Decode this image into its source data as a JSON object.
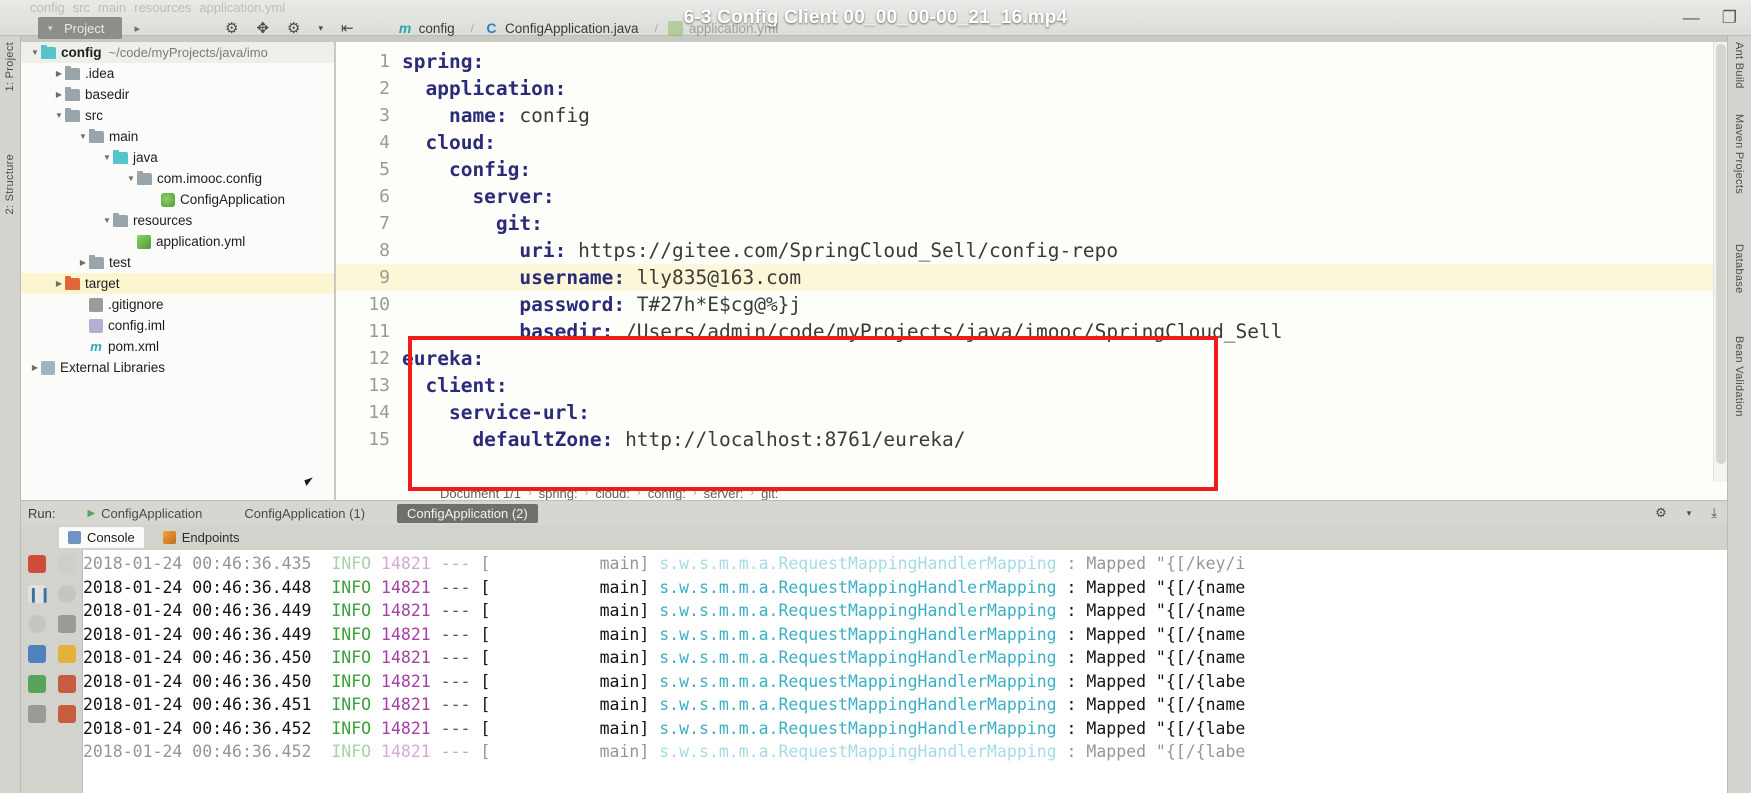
{
  "window": {
    "video_title": "6-3 Config Client 00_00_00-00_21_16.mp4",
    "minimize_label": "—",
    "maximize_label": "❐"
  },
  "ghost_breadcrumb": [
    "config",
    "src",
    "main",
    "resources",
    "application.yml"
  ],
  "toolbar": {
    "project_chip": "Project",
    "chip_chevron": "▾",
    "nav_arrow": "▸",
    "icons": [
      {
        "name": "sync-icon",
        "glyph": "⚙"
      },
      {
        "name": "target-icon",
        "glyph": "✥"
      },
      {
        "name": "settings-icon",
        "glyph": "⚙"
      },
      {
        "name": "settings-dropdown-icon",
        "glyph": "▾"
      },
      {
        "name": "collapse-all-icon",
        "glyph": "⇤"
      }
    ],
    "editor_tabs": [
      {
        "label": "config",
        "icon": "maven-icon"
      },
      {
        "label": "ConfigApplication.java",
        "icon": "java-class-icon"
      },
      {
        "label": "application.yml",
        "icon": "yaml-file-icon"
      }
    ]
  },
  "left_strip": [
    "1: Project",
    "2: Structure"
  ],
  "right_strip": [
    "Ant Build",
    "Maven Projects",
    "Database",
    "Bean Validation"
  ],
  "tree": {
    "rows": [
      {
        "label": "config",
        "path": "~/code/myProjects/java/imo",
        "indent": 0,
        "arrow": "open",
        "icon": "module-folder",
        "style": "root"
      },
      {
        "label": ".idea",
        "path": "",
        "indent": 1,
        "arrow": "closed",
        "icon": "folder-gray",
        "style": ""
      },
      {
        "label": "basedir",
        "path": "",
        "indent": 1,
        "arrow": "closed",
        "icon": "folder-gray",
        "style": ""
      },
      {
        "label": "src",
        "path": "",
        "indent": 1,
        "arrow": "open",
        "icon": "folder-gray",
        "style": ""
      },
      {
        "label": "main",
        "path": "",
        "indent": 2,
        "arrow": "open",
        "icon": "folder-gray",
        "style": ""
      },
      {
        "label": "java",
        "path": "",
        "indent": 3,
        "arrow": "open",
        "icon": "folder-cyan",
        "style": ""
      },
      {
        "label": "com.imooc.config",
        "path": "",
        "indent": 4,
        "arrow": "open",
        "icon": "folder-gray",
        "style": ""
      },
      {
        "label": "ConfigApplication",
        "path": "",
        "indent": 5,
        "arrow": "none",
        "icon": "spring-class",
        "style": ""
      },
      {
        "label": "resources",
        "path": "",
        "indent": 3,
        "arrow": "open",
        "icon": "folder-gray",
        "style": ""
      },
      {
        "label": "application.yml",
        "path": "",
        "indent": 4,
        "arrow": "none",
        "icon": "yaml-file",
        "style": ""
      },
      {
        "label": "test",
        "path": "",
        "indent": 2,
        "arrow": "closed",
        "icon": "folder-gray",
        "style": ""
      },
      {
        "label": "target",
        "path": "",
        "indent": 1,
        "arrow": "closed",
        "icon": "folder-orange",
        "style": "hl"
      },
      {
        "label": ".gitignore",
        "path": "",
        "indent": 2,
        "arrow": "none",
        "icon": "gitignore-file",
        "style": ""
      },
      {
        "label": "config.iml",
        "path": "",
        "indent": 2,
        "arrow": "none",
        "icon": "iml-file",
        "style": ""
      },
      {
        "label": "pom.xml",
        "path": "",
        "indent": 2,
        "arrow": "none",
        "icon": "maven-pom-file",
        "style": ""
      },
      {
        "label": "External Libraries",
        "path": "",
        "indent": 0,
        "arrow": "closed",
        "icon": "libraries",
        "style": ""
      }
    ]
  },
  "editor": {
    "lines": [
      {
        "n": "1",
        "indent": 0,
        "key": "spring:",
        "value": "",
        "hl": false
      },
      {
        "n": "2",
        "indent": 1,
        "key": "application:",
        "value": "",
        "hl": false
      },
      {
        "n": "3",
        "indent": 2,
        "key": "name:",
        "value": " config",
        "hl": false
      },
      {
        "n": "4",
        "indent": 1,
        "key": "cloud:",
        "value": "",
        "hl": false
      },
      {
        "n": "5",
        "indent": 2,
        "key": "config:",
        "value": "",
        "hl": false
      },
      {
        "n": "6",
        "indent": 3,
        "key": "server:",
        "value": "",
        "hl": false
      },
      {
        "n": "7",
        "indent": 4,
        "key": "git:",
        "value": "",
        "hl": false
      },
      {
        "n": "8",
        "indent": 5,
        "key": "uri:",
        "value": " https://gitee.com/SpringCloud_Sell/config-repo",
        "hl": false
      },
      {
        "n": "9",
        "indent": 5,
        "key": "username:",
        "value": " lly835@163.com",
        "hl": true
      },
      {
        "n": "10",
        "indent": 5,
        "key": "password:",
        "value": " T#27h*E$cg@%}j",
        "hl": false
      },
      {
        "n": "11",
        "indent": 5,
        "key": "basedir:",
        "value": " /Users/admin/code/myProjects/java/imooc/SpringCloud_Sell",
        "hl": false
      },
      {
        "n": "12",
        "indent": 0,
        "key": "eureka:",
        "value": "",
        "hl": false
      },
      {
        "n": "13",
        "indent": 1,
        "key": "client:",
        "value": "",
        "hl": false
      },
      {
        "n": "14",
        "indent": 2,
        "key": "service-url:",
        "value": "",
        "hl": false
      },
      {
        "n": "15",
        "indent": 3,
        "key": "defaultZone:",
        "value": " http://localhost:8761/eureka/",
        "hl": false
      }
    ],
    "scrollbar_status_icon": "✓"
  },
  "breadcrumbs": {
    "document": "Document 1/1",
    "items": [
      "spring:",
      "cloud:",
      "config:",
      "server:",
      "git:"
    ],
    "separator": "›"
  },
  "run_bar": {
    "label": "Run:",
    "tabs": [
      {
        "label": "ConfigApplication",
        "active": false
      },
      {
        "label": "ConfigApplication (1)",
        "active": false
      },
      {
        "label": "ConfigApplication (2)",
        "active": true
      }
    ],
    "right_icons": [
      {
        "name": "settings-icon",
        "glyph": "⚙"
      },
      {
        "name": "settings-dropdown-icon",
        "glyph": "▾"
      },
      {
        "name": "hide-icon",
        "glyph": "⤓"
      }
    ]
  },
  "console_tabs": [
    {
      "label": "Console",
      "active": true,
      "icon": "console-icon"
    },
    {
      "label": "Endpoints",
      "active": false,
      "icon": "endpoints-icon"
    }
  ],
  "console_side_buttons": [
    {
      "name": "stop-button",
      "glyph": "■"
    },
    {
      "name": "scroll-up-button",
      "glyph": "↑"
    },
    {
      "name": "rerun-button",
      "glyph": "⏸"
    },
    {
      "name": "soft-wrap-button",
      "glyph": "≡"
    },
    {
      "name": "filter-button",
      "glyph": "●"
    },
    {
      "name": "scroll-end-button",
      "glyph": "⬇"
    },
    {
      "name": "print-button",
      "glyph": "⎙"
    },
    {
      "name": "export-button",
      "glyph": "↳"
    },
    {
      "name": "grid-button",
      "glyph": "▦"
    },
    {
      "name": "clear-all-button",
      "glyph": "🗑"
    }
  ],
  "console_log": {
    "lines": [
      {
        "ts": "2018-01-24 00:46:36.435",
        "level": "INFO",
        "pid": "14821",
        "dash": "---",
        "thread": "main]",
        "cls": "s.w.s.m.m.a.RequestMappingHandlerMapping",
        "msg": ": Mapped \"{[/key/i",
        "fade": true
      },
      {
        "ts": "2018-01-24 00:46:36.448",
        "level": "INFO",
        "pid": "14821",
        "dash": "---",
        "thread": "main]",
        "cls": "s.w.s.m.m.a.RequestMappingHandlerMapping",
        "msg": ": Mapped \"{[/{name",
        "fade": false
      },
      {
        "ts": "2018-01-24 00:46:36.449",
        "level": "INFO",
        "pid": "14821",
        "dash": "---",
        "thread": "main]",
        "cls": "s.w.s.m.m.a.RequestMappingHandlerMapping",
        "msg": ": Mapped \"{[/{name",
        "fade": false
      },
      {
        "ts": "2018-01-24 00:46:36.449",
        "level": "INFO",
        "pid": "14821",
        "dash": "---",
        "thread": "main]",
        "cls": "s.w.s.m.m.a.RequestMappingHandlerMapping",
        "msg": ": Mapped \"{[/{name",
        "fade": false
      },
      {
        "ts": "2018-01-24 00:46:36.450",
        "level": "INFO",
        "pid": "14821",
        "dash": "---",
        "thread": "main]",
        "cls": "s.w.s.m.m.a.RequestMappingHandlerMapping",
        "msg": ": Mapped \"{[/{name",
        "fade": false
      },
      {
        "ts": "2018-01-24 00:46:36.450",
        "level": "INFO",
        "pid": "14821",
        "dash": "---",
        "thread": "main]",
        "cls": "s.w.s.m.m.a.RequestMappingHandlerMapping",
        "msg": ": Mapped \"{[/{labe",
        "fade": false
      },
      {
        "ts": "2018-01-24 00:46:36.451",
        "level": "INFO",
        "pid": "14821",
        "dash": "---",
        "thread": "main]",
        "cls": "s.w.s.m.m.a.RequestMappingHandlerMapping",
        "msg": ": Mapped \"{[/{name",
        "fade": false
      },
      {
        "ts": "2018-01-24 00:46:36.452",
        "level": "INFO",
        "pid": "14821",
        "dash": "---",
        "thread": "main]",
        "cls": "s.w.s.m.m.a.RequestMappingHandlerMapping",
        "msg": ": Mapped \"{[/{labe",
        "fade": false
      },
      {
        "ts": "2018-01-24 00:46:36.452",
        "level": "INFO",
        "pid": "14821",
        "dash": "---",
        "thread": "main]",
        "cls": "s.w.s.m.m.a.RequestMappingHandlerMapping",
        "msg": ": Mapped \"{[/{labe",
        "fade": true
      }
    ]
  },
  "colors": {
    "annotation_red": "#f01b1b",
    "yaml_key": "#2b2b7a",
    "log_info_green": "#3aa03a",
    "log_pid_purple": "#a43fa4",
    "log_class_cyan": "#3bb0c4",
    "highlight_line": "#fbf7d8"
  }
}
